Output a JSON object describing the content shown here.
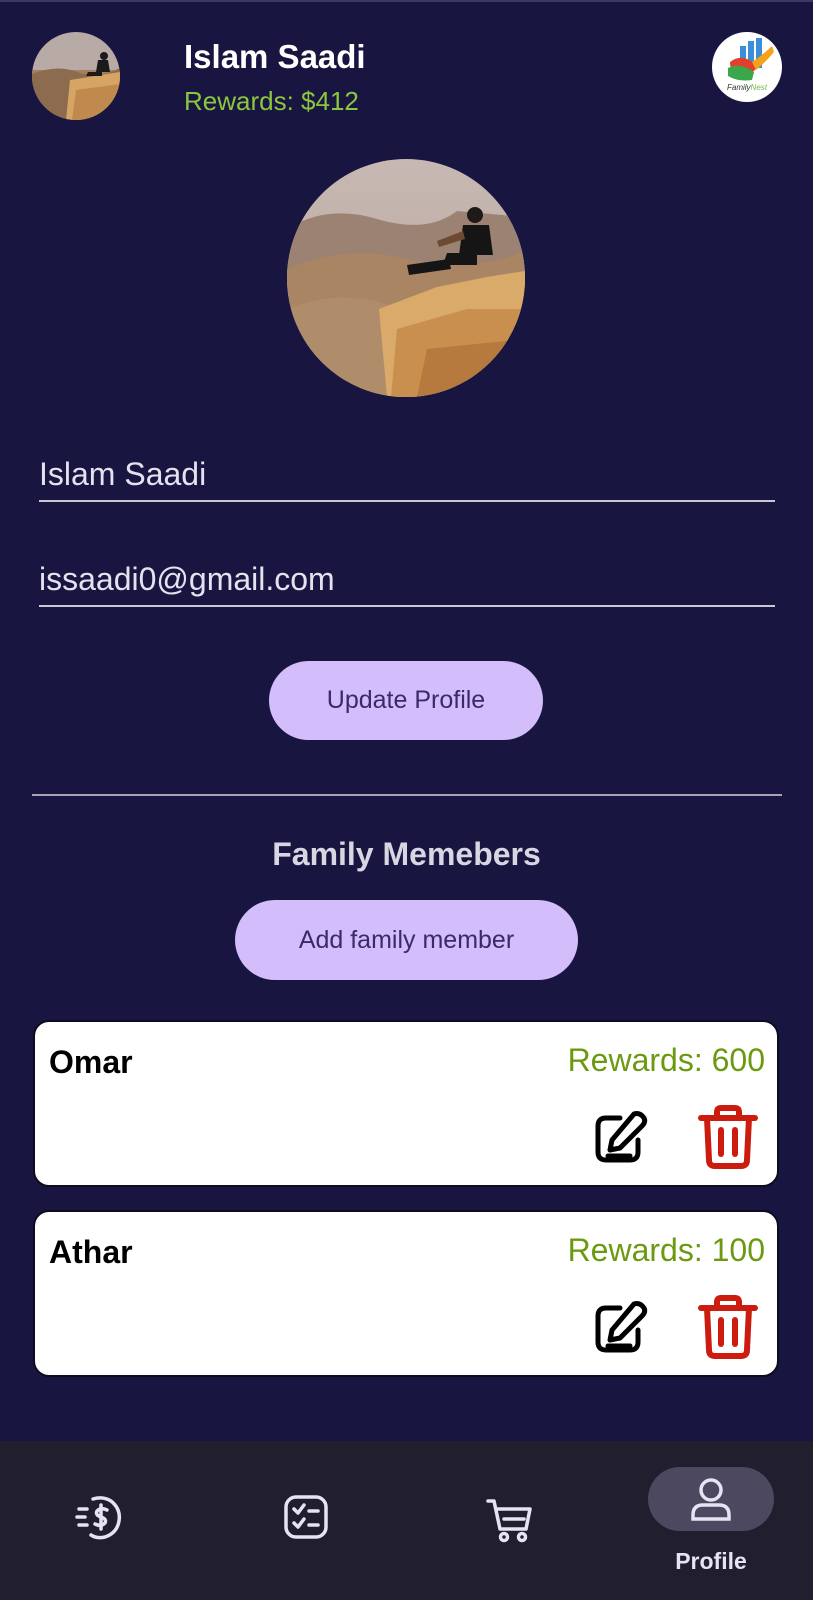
{
  "header": {
    "name": "Islam Saadi",
    "rewards": "Rewards: $412",
    "logo_text": "FamilyNest"
  },
  "profile": {
    "name_value": "Islam Saadi",
    "email_value": "issaadi0@gmail.com",
    "update_button": "Update Profile"
  },
  "family": {
    "title": "Family Memebers",
    "add_button": "Add family member",
    "members": [
      {
        "name": "Omar",
        "rewards": "Rewards: 600"
      },
      {
        "name": "Athar",
        "rewards": "Rewards: 100"
      }
    ]
  },
  "nav": {
    "items": [
      {
        "icon": "money-icon"
      },
      {
        "icon": "tasks-icon"
      },
      {
        "icon": "cart-icon"
      },
      {
        "icon": "profile-icon",
        "label": "Profile"
      }
    ]
  },
  "colors": {
    "background": "#181640",
    "accent": "#d3bdfa",
    "rewards_green": "#8cc63f",
    "delete_red": "#cc1c10"
  }
}
